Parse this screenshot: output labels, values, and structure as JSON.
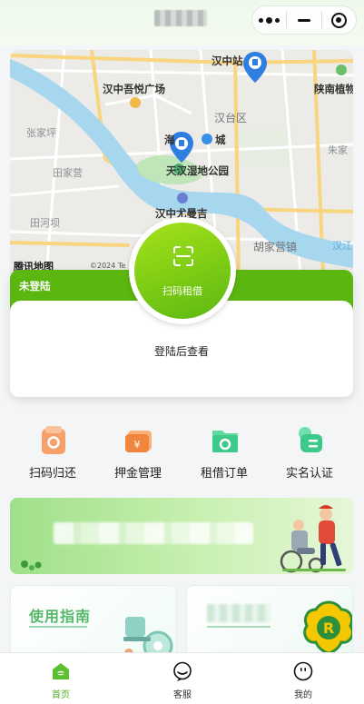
{
  "header": {
    "title_obscured": true
  },
  "capsule": {
    "more_icon": "more-dots-icon",
    "minimize_icon": "minimize-icon",
    "close_icon": "target-close-icon"
  },
  "map": {
    "labels": {
      "hanzhong_station": "汉中站",
      "wuyue_plaza": "汉中吾悦广场",
      "hantai_district": "汉台区",
      "zhangjiaping": "张家坪",
      "tianjiaying": "田家营",
      "tianhe_ba": "田河坝",
      "tianhan_park": "天汉湿地公园",
      "hanzhong_youyou": "汉中尤曼吉",
      "hu_jiaying": "胡家营镇",
      "zhukou": "朱家",
      "shaanxi_plant": "陕南植物",
      "hai_cheng": "海",
      "cheng": "城",
      "river": "汉江"
    },
    "provider_logo": "腾讯地图",
    "copyright": "©2024 Te"
  },
  "scan": {
    "label": "扫码租借"
  },
  "login_card": {
    "status": "未登陆",
    "hint": "登陆后查看"
  },
  "actions": [
    {
      "label": "扫码归还",
      "icon": "scan-return-icon",
      "color": "#f08a55"
    },
    {
      "label": "押金管理",
      "icon": "deposit-card-icon",
      "color": "#f0863e"
    },
    {
      "label": "租借订单",
      "icon": "order-folder-icon",
      "color": "#3cc98a"
    },
    {
      "label": "实名认证",
      "icon": "id-card-icon",
      "color": "#3cc98a"
    }
  ],
  "guide": {
    "title": "使用指南"
  },
  "tabbar": [
    {
      "label": "首页",
      "icon": "home-icon",
      "active": true
    },
    {
      "label": "客服",
      "icon": "customer-service-icon",
      "active": false
    },
    {
      "label": "我的",
      "icon": "profile-icon",
      "active": false
    }
  ],
  "colors": {
    "brand_green": "#5cb610",
    "accent_green": "#4fae22",
    "guide_green": "#55b86b"
  }
}
